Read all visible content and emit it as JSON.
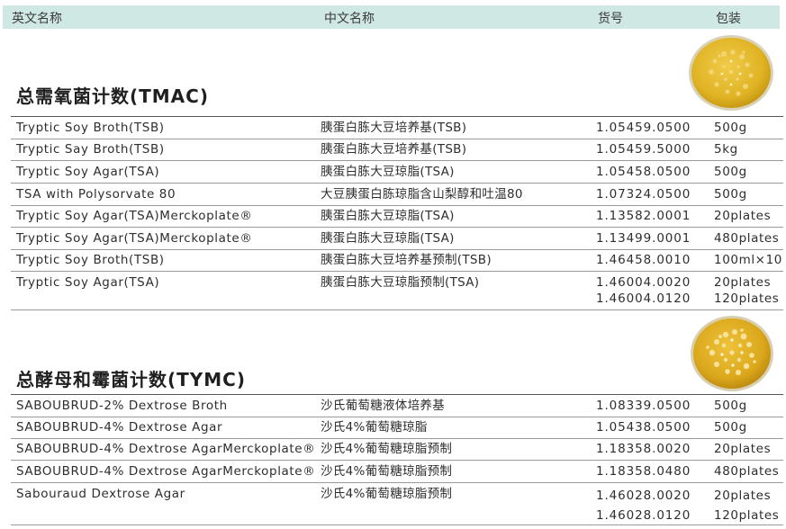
{
  "header": {
    "col_en": "英文名称",
    "col_cn": "中文名称",
    "col_code": "货号",
    "col_pack": "包装"
  },
  "sections": [
    {
      "title": "总需氧菌计数(TMAC)",
      "image_icon": "petri-dish-tmac",
      "rows": [
        {
          "en": "Tryptic Soy Broth(TSB)",
          "cn": "胰蛋白胨大豆培养基(TSB)",
          "codes": [
            "1.05459.0500"
          ],
          "packs": [
            "500g"
          ]
        },
        {
          "en": "Tryptic Say Broth(TSB)",
          "cn": "胰蛋白胨大豆培养基(TSB)",
          "codes": [
            "1.05459.5000"
          ],
          "packs": [
            "5kg"
          ]
        },
        {
          "en": "Tryptic Soy Agar(TSA)",
          "cn": "胰蛋白胨大豆琼脂(TSA)",
          "codes": [
            "1.05458.0500"
          ],
          "packs": [
            "500g"
          ]
        },
        {
          "en": "TSA with Polysorvate 80",
          "cn": "大豆胰蛋白胨琼脂含山梨醇和吐温80",
          "codes": [
            "1.07324.0500"
          ],
          "packs": [
            "500g"
          ]
        },
        {
          "en": "Tryptic Soy Agar(TSA)Merckoplate®",
          "cn": "胰蛋白胨大豆琼脂(TSA)",
          "codes": [
            "1.13582.0001"
          ],
          "packs": [
            "20plates"
          ]
        },
        {
          "en": "Tryptic Soy Agar(TSA)Merckoplate®",
          "cn": "胰蛋白胨大豆琼脂(TSA)",
          "codes": [
            "1.13499.0001"
          ],
          "packs": [
            "480plates"
          ]
        },
        {
          "en": "Tryptic Soy Broth(TSB)",
          "cn": "胰蛋白胨大豆培养基预制(TSB)",
          "codes": [
            "1.46458.0010"
          ],
          "packs": [
            "100ml×10"
          ]
        },
        {
          "en": "Tryptic Soy Agar(TSA)",
          "cn": "胰蛋白胨大豆琼脂预制(TSA)",
          "codes": [
            "1.46004.0020",
            "1.46004.0120"
          ],
          "packs": [
            "20plates",
            "120plates"
          ]
        }
      ]
    },
    {
      "title": "总酵母和霉菌计数(TYMC)",
      "image_icon": "petri-dish-tymc",
      "rows": [
        {
          "en": "SABOUBRUD-2% Dextrose Broth",
          "cn": "沙氏葡萄糖液体培养基",
          "codes": [
            "1.08339.0500"
          ],
          "packs": [
            "500g"
          ]
        },
        {
          "en": "SABOUBRUD-4% Dextrose Agar",
          "cn": "沙氏4%葡萄糖琼脂",
          "codes": [
            "1.05438.0500"
          ],
          "packs": [
            "500g"
          ]
        },
        {
          "en": "SABOUBRUD-4% Dextrose AgarMerckoplate®",
          "cn": "沙氏4%葡萄糖琼脂预制",
          "codes": [
            "1.18358.0020"
          ],
          "packs": [
            "20plates"
          ]
        },
        {
          "en": "SABOUBRUD-4% Dextrose AgarMerckoplate®",
          "cn": "沙氏4%葡萄糖琼脂预制",
          "codes": [
            "1.18358.0480"
          ],
          "packs": [
            "480plates"
          ]
        },
        {
          "en": "Sabouraud Dextrose Agar",
          "cn": "沙氏4%葡萄糖琼脂预制",
          "codes": [
            "1.46028.0020",
            "1.46028.0120"
          ],
          "packs": [
            "20plates",
            "120plates"
          ]
        }
      ]
    }
  ],
  "colors": {
    "header_bg": "#cfe8e3",
    "dish_gold": "#e4b82a",
    "rule": "#9a9a9a"
  }
}
